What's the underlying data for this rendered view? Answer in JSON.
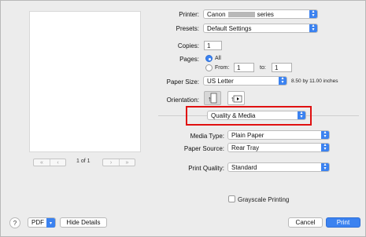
{
  "preview": {
    "page_count": "1 of 1",
    "first": "«",
    "prev": "‹",
    "next": "›",
    "last": "»"
  },
  "printer": {
    "label": "Printer:",
    "value_prefix": "Canon",
    "value_suffix": "series"
  },
  "presets": {
    "label": "Presets:",
    "value": "Default Settings"
  },
  "copies": {
    "label": "Copies:",
    "value": "1"
  },
  "pages": {
    "label": "Pages:",
    "all_label": "All",
    "from_label": "From:",
    "from_value": "1",
    "to_label": "to:",
    "to_value": "1",
    "selected": "All"
  },
  "paper_size": {
    "label": "Paper Size:",
    "value": "US Letter",
    "dimensions": "8.50 by 11.00 inches"
  },
  "orientation": {
    "label": "Orientation:",
    "selected": "portrait"
  },
  "section": {
    "value": "Quality & Media"
  },
  "media_type": {
    "label": "Media Type:",
    "value": "Plain Paper"
  },
  "paper_source": {
    "label": "Paper Source:",
    "value": "Rear Tray"
  },
  "print_quality": {
    "label": "Print Quality:",
    "value": "Standard"
  },
  "grayscale": {
    "label": "Grayscale Printing",
    "checked": false
  },
  "footer": {
    "help": "?",
    "pdf": "PDF",
    "hide_details": "Hide Details",
    "cancel": "Cancel",
    "print": "Print"
  },
  "colors": {
    "accent": "#3b82f0",
    "highlight": "#e01010",
    "dialog_bg": "#ececec"
  }
}
